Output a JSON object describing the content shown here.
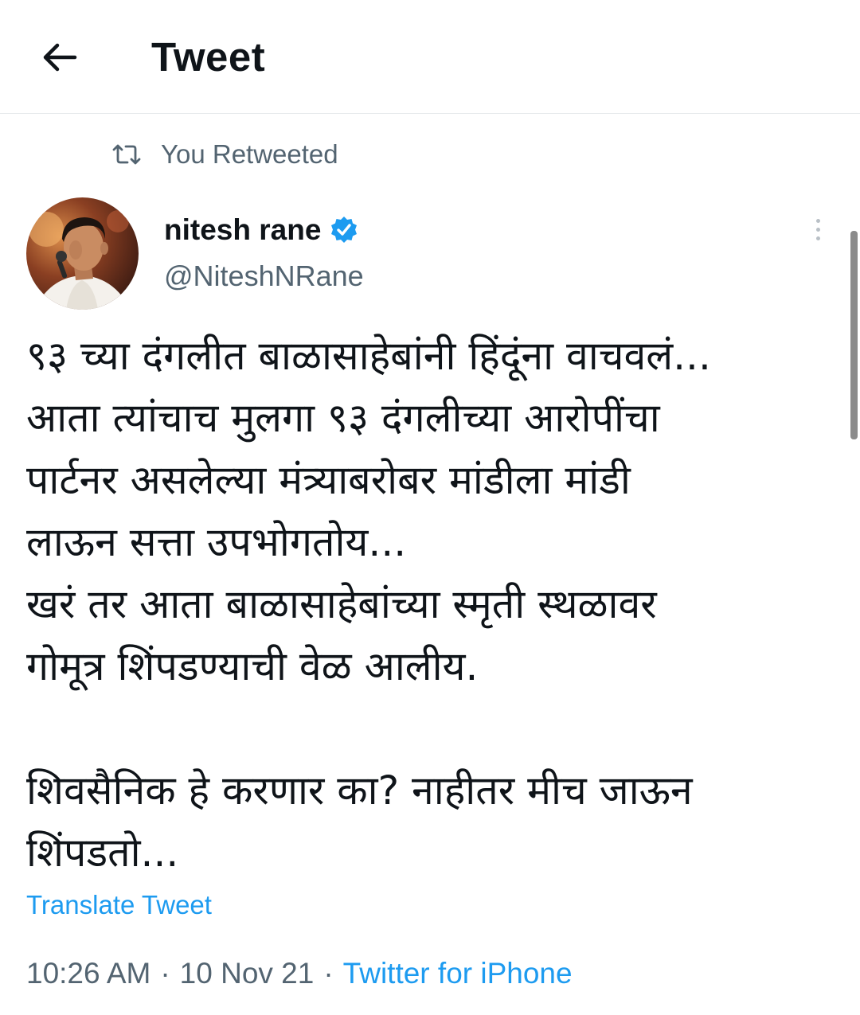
{
  "header": {
    "title": "Tweet",
    "back_icon": "arrow-left-icon"
  },
  "retweet_context": {
    "icon": "retweet-icon",
    "text": "You Retweeted"
  },
  "author": {
    "display_name": "nitesh rane",
    "handle": "@NiteshNRane",
    "verified": true,
    "verified_icon": "verified-badge-icon"
  },
  "tweet": {
    "lines": [
      "९३ च्या दंगलीत बाळासाहेबांनी हिंदूंना वाचवलं...",
      "आता त्यांचाच मुलगा ९३ दंगलीच्या आरोपींचा",
      "पार्टनर असलेल्या मंत्र्याबरोबर मांडीला मांडी",
      "लाऊन सत्ता उपभोगतोय...",
      "खरं तर आता बाळासाहेबांच्या स्मृती स्थळावर",
      "गोमूत्र शिंपडण्याची वेळ आलीय.",
      "शिवसैनिक हे करणार का? नाहीतर मीच जाऊन",
      "शिंपडतो..."
    ],
    "translate_label": "Translate Tweet",
    "time": "10:26 AM",
    "date": "10 Nov 21",
    "separator": "·",
    "source": "Twitter for iPhone"
  },
  "colors": {
    "accent": "#1d9bf0",
    "secondary_text": "#536471",
    "primary_text": "#0f1419",
    "divider": "#e6e9ec"
  }
}
